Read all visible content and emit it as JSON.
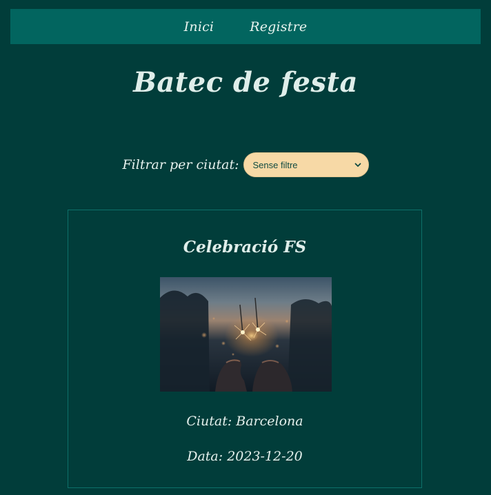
{
  "nav": {
    "items": [
      {
        "label": "Inici"
      },
      {
        "label": "Registre"
      }
    ]
  },
  "header": {
    "title": "Batec de festa"
  },
  "filter": {
    "label": "Filtrar per ciutat:",
    "selected": "Sense filtre",
    "icon": "chevron-down-icon"
  },
  "events": [
    {
      "title": "Celebració FS",
      "city": "Ciutat: Barcelona",
      "date": "Data: 2023-12-20"
    }
  ],
  "colors": {
    "page_background": "#013d3a",
    "navbar_background": "#02655f",
    "select_background": "#f7d9a6",
    "card_border": "#0d7069",
    "text": "#e6f1ed"
  }
}
